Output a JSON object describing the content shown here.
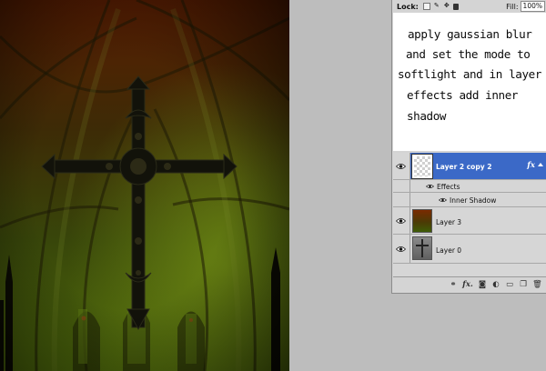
{
  "lock_bar": {
    "lock_label": "Lock:",
    "fill_label": "Fill:",
    "fill_value": "100%"
  },
  "note": {
    "lines": [
      "apply gaussian blur",
      "and set the mode to",
      "softlight and in layer",
      "effects add inner",
      "shadow"
    ]
  },
  "layers": [
    {
      "name": "Layer 2 copy 2",
      "selected": true,
      "visible": true,
      "has_effects": true,
      "fx_label": "fx"
    },
    {
      "name": "Layer 3",
      "selected": false,
      "visible": true,
      "has_effects": false
    },
    {
      "name": "Layer 0",
      "selected": false,
      "visible": true,
      "has_effects": false
    }
  ],
  "effects": {
    "label": "Effects",
    "items": [
      "Inner Shadow"
    ]
  },
  "bottom_bar_icons": [
    "link-layers-icon",
    "fx-icon",
    "layer-mask-icon",
    "adjustment-layer-icon",
    "new-group-icon",
    "new-layer-icon",
    "trash-icon"
  ],
  "bottom_bar_fx": "fx.",
  "colors": {
    "selection": "#3b69c7",
    "panel_bg": "#d4d4d4",
    "workspace_bg": "#bdbdbd"
  }
}
